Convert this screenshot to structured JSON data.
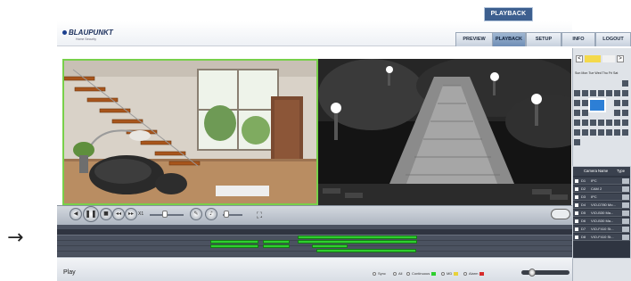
{
  "pointer": {
    "icon": "right-arrow-icon",
    "glyph": "→"
  },
  "header": {
    "badge": "PLAYBACK",
    "logo": "BLAUPUNKT",
    "logo_sub": "Home Security",
    "nav": [
      "PREVIEW",
      "PLAYBACK",
      "SETUP",
      "INFO",
      "LOGOUT"
    ],
    "active_nav": "PLAYBACK"
  },
  "player": {
    "controls": [
      "previous-icon",
      "pause-icon",
      "stop-icon",
      "rewind-icon",
      "forward-icon"
    ],
    "speed": "X1",
    "speed_level": 0.45,
    "volume_level": 0.2,
    "glyphs": {
      "prev": "◀",
      "pause": "❚❚",
      "stop": "■",
      "rew": "◂◂",
      "fwd": "▸▸",
      "snap": "✎",
      "vol": "♪",
      "full": "⛶"
    }
  },
  "calendar": {
    "day_headers": "Sun Mon Tue Wed Thu Fri Sat",
    "prev": "<",
    "next": ">"
  },
  "camera_list": {
    "headers": {
      "name": "Camera Name",
      "type": "Type"
    },
    "rows": [
      {
        "no": "D1",
        "name": "IPC"
      },
      {
        "no": "D2",
        "name": "CAM 2"
      },
      {
        "no": "D3",
        "name": "IPC"
      },
      {
        "no": "D4",
        "name": "VIO-D780 Mo..."
      },
      {
        "no": "D5",
        "name": "VIO-B30 Ma..."
      },
      {
        "no": "D6",
        "name": "VIO-B30 Ma..."
      },
      {
        "no": "D7",
        "name": "VIO-F410 St..."
      },
      {
        "no": "D8",
        "name": "VIO-F410 St..."
      }
    ]
  },
  "footer": {
    "play_label": "Play",
    "legend": {
      "sync": "Sync",
      "all": "All",
      "continuous": "Continuous",
      "md": "MD",
      "alarm": "Alarm"
    },
    "colors": {
      "continuous": "#2fcf2f",
      "md": "#e8d23a",
      "alarm": "#d62b2b"
    }
  },
  "colors": {
    "accent": "#3d5f8f",
    "recording": "#2fcf2f",
    "selection_border": "#78d04a"
  }
}
